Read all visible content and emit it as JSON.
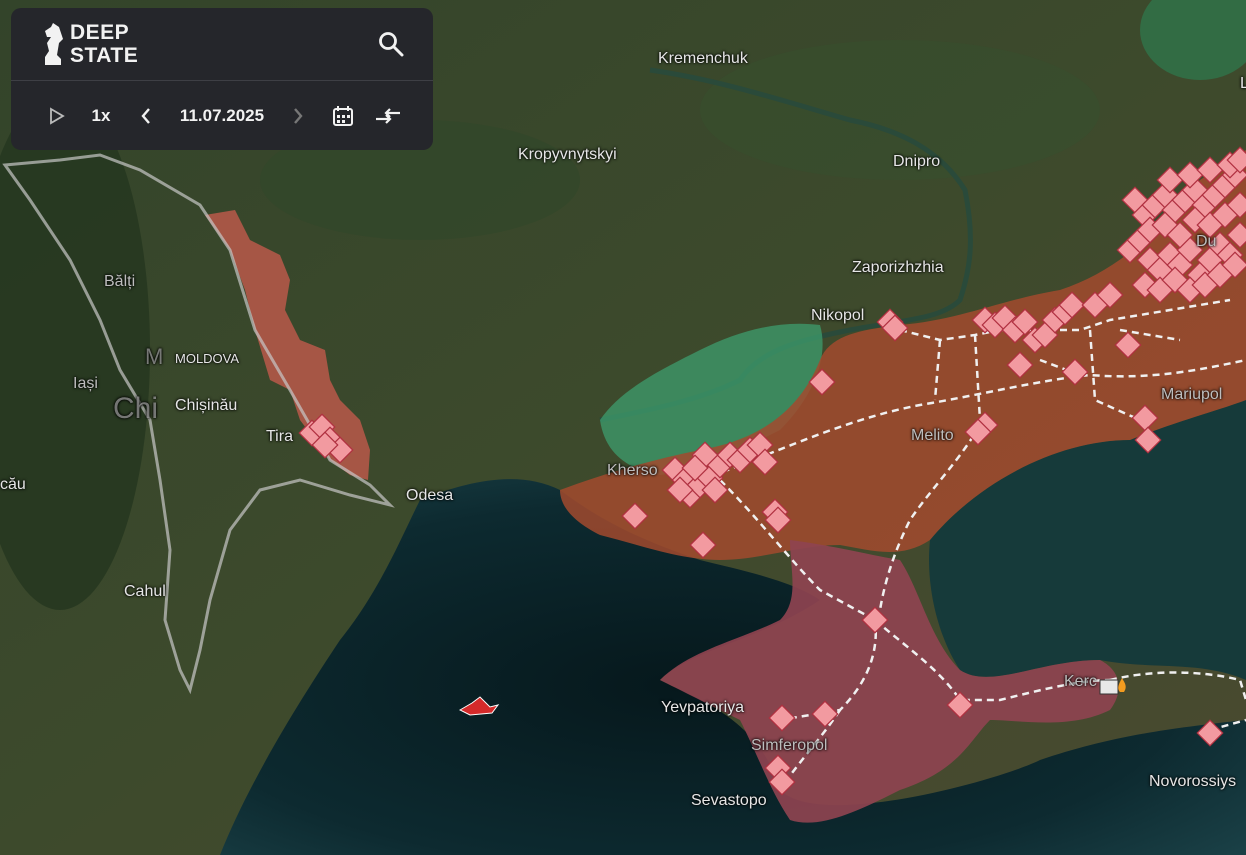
{
  "app": {
    "logo_line1": "DEEP",
    "logo_line2": "STATE",
    "speed": "1x",
    "date": "11.07.2025",
    "icons": {
      "play": "play-icon",
      "prev": "chevron-left-icon",
      "next": "chevron-right-icon",
      "calendar": "calendar-icon",
      "compare": "compare-arrows-icon",
      "search": "search-icon"
    }
  },
  "map": {
    "cities": {
      "kremenchuk": "Kremenchuk",
      "kropyvnytskyi": "Kropyvnytskyi",
      "dnipro": "Dnipro",
      "zaporizhzhia": "Zaporizhzhia",
      "nikopol": "Nikopol",
      "balti": "Bălți",
      "moldova": "MOLDOVA",
      "iasi": "Iași",
      "chisinau": "Chișinău",
      "chi_big": "Chi",
      "m_big": "M",
      "tiraspol": "Tira",
      "odesa": "Odesa",
      "cau": "cău",
      "cahul": "Cahul",
      "kherson": "Kherso",
      "melitopol": "Melito",
      "mariupol": "Mariupol",
      "du": "Du",
      "yevpatoriya": "Yevpatoriya",
      "simferopol": "Simferopol",
      "sevastopol": "Sevastopo",
      "kerch": "Kerc",
      "novorossiysk": "Novorossiys",
      "l_edge": "L"
    },
    "colors": {
      "occupied": "#a24a2e",
      "crimea": "#8e4350",
      "liberated": "#3d9e6e",
      "transnistria": "#c25a4c",
      "marker": "#f29aa0",
      "sea": "#0d2228"
    }
  }
}
